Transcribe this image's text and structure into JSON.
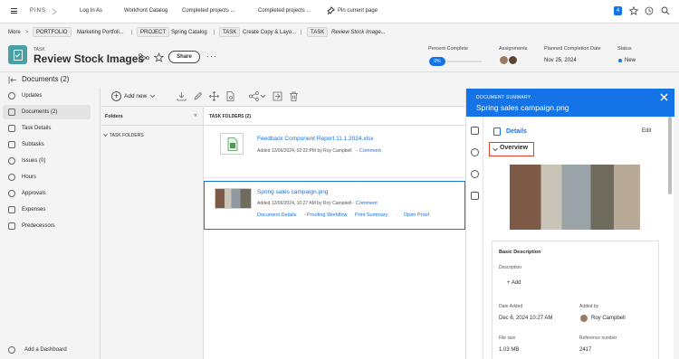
{
  "topbar": {
    "pins_label": "PINS",
    "pins": [
      "Log In As",
      "Workfront Catalog",
      "Completed projects ...",
      "Completed projects ..."
    ],
    "pin_current_label": "Pin current page",
    "notification_count": "4"
  },
  "breadcrumb": {
    "more": "More",
    "items": [
      {
        "type": "PORTFOLIO",
        "name": "Marketing Portfoli..."
      },
      {
        "type": "PROJECT",
        "name": "Spring Catalog"
      },
      {
        "type": "TASK",
        "name": "Create Copy & Layo..."
      },
      {
        "type": "TASK",
        "name": "Review Stock Image..."
      }
    ]
  },
  "header": {
    "object_type": "TASK",
    "title": "Review Stock Images",
    "share_label": "Share",
    "percent_complete_label": "Percent Complete",
    "percent_complete_value": "0%",
    "assignments_label": "Assignments",
    "planned_completion_label": "Planned Completion Date",
    "planned_completion_value": "Nov 25, 2024",
    "status_label": "Status",
    "status_value": "New",
    "status_color": "#1473e6"
  },
  "docbar": {
    "title": "Documents (2)"
  },
  "sidebar": {
    "items": [
      {
        "label": "Updates",
        "icon": "updates-icon"
      },
      {
        "label": "Documents (2)",
        "icon": "documents-icon"
      },
      {
        "label": "Task Details",
        "icon": "task-details-icon"
      },
      {
        "label": "Subtasks",
        "icon": "subtasks-icon"
      },
      {
        "label": "Issues (0)",
        "icon": "issues-icon"
      },
      {
        "label": "Hours",
        "icon": "clock-icon"
      },
      {
        "label": "Approvals",
        "icon": "approvals-icon"
      },
      {
        "label": "Expenses",
        "icon": "expenses-icon"
      },
      {
        "label": "Predecessors",
        "icon": "predecessors-icon"
      }
    ],
    "add_dashboard": "Add a Dashboard"
  },
  "toolbar": {
    "add_new_label": "Add new"
  },
  "folders": {
    "title": "Folders",
    "task_folders": "TASK FOLDERS",
    "list_header": "TASK FOLDERS (2)"
  },
  "documents": [
    {
      "name": "Feedback Component Report 11.1.2024.xlsx",
      "meta": "Added 12/06/2024, 02:22 PM by Roy Campbell",
      "comment": "Comment"
    },
    {
      "name": "Spring sales campaign.png",
      "meta": "Added 12/06/2024, 10:27 AM by Roy Campbell",
      "comment": "Comment",
      "actions": [
        "Document Details",
        "Proofing Workflow",
        "Print Summary",
        "Open Proof"
      ]
    }
  ],
  "summary": {
    "heading": "DOCUMENT SUMMARY",
    "doc_name": "Spring sales campaign.png",
    "details_label": "Details",
    "edit_label": "Edit",
    "overview_label": "Overview",
    "basic_description": "Basic Description",
    "description_label": "Description",
    "add_label": "+ Add",
    "date_added_label": "Date Added",
    "date_added_value": "Dec 6, 2024 10:27 AM",
    "added_by_label": "Added by",
    "added_by_value": "Roy Campbell",
    "file_size_label": "File size",
    "file_size_value": "1.03 MB",
    "reference_number_label": "Reference number",
    "reference_number_value": "2417"
  },
  "colors": {
    "accent": "#1473e6",
    "highlight": "#e0412f",
    "task_icon": "#47a1a6"
  }
}
